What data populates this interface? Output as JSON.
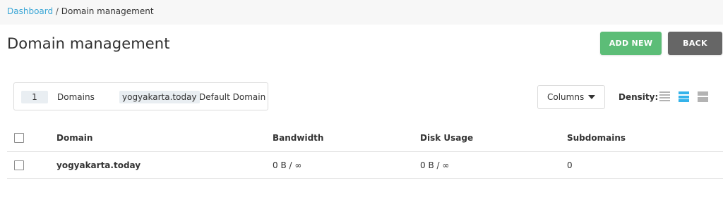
{
  "breadcrumb": {
    "dashboard": "Dashboard",
    "separator": " / ",
    "current": "Domain management"
  },
  "page": {
    "title": "Domain management"
  },
  "buttons": {
    "add_new": "ADD NEW",
    "back": "BACK"
  },
  "summary": {
    "count": "1",
    "count_label": "Domains",
    "default_domain": "yogyakarta.today",
    "default_label": "Default Domain"
  },
  "toolbar": {
    "columns_label": "Columns",
    "density_label": "Density:",
    "density_options": [
      "compact-icon",
      "standard-icon",
      "comfortable-icon"
    ],
    "density_selected": "standard"
  },
  "table": {
    "headers": {
      "domain": "Domain",
      "bandwidth": "Bandwidth",
      "disk_usage": "Disk Usage",
      "subdomains": "Subdomains"
    },
    "rows": [
      {
        "domain": "yogyakarta.today",
        "bandwidth": "0 B / ∞",
        "disk_usage": "0 B / ∞",
        "subdomains": "0"
      }
    ]
  },
  "colors": {
    "link": "#3aa6d6",
    "add_button": "#5cbd77",
    "back_button": "#666666",
    "density_active": "#35b3ea",
    "density_inactive": "#b3b3b3"
  }
}
